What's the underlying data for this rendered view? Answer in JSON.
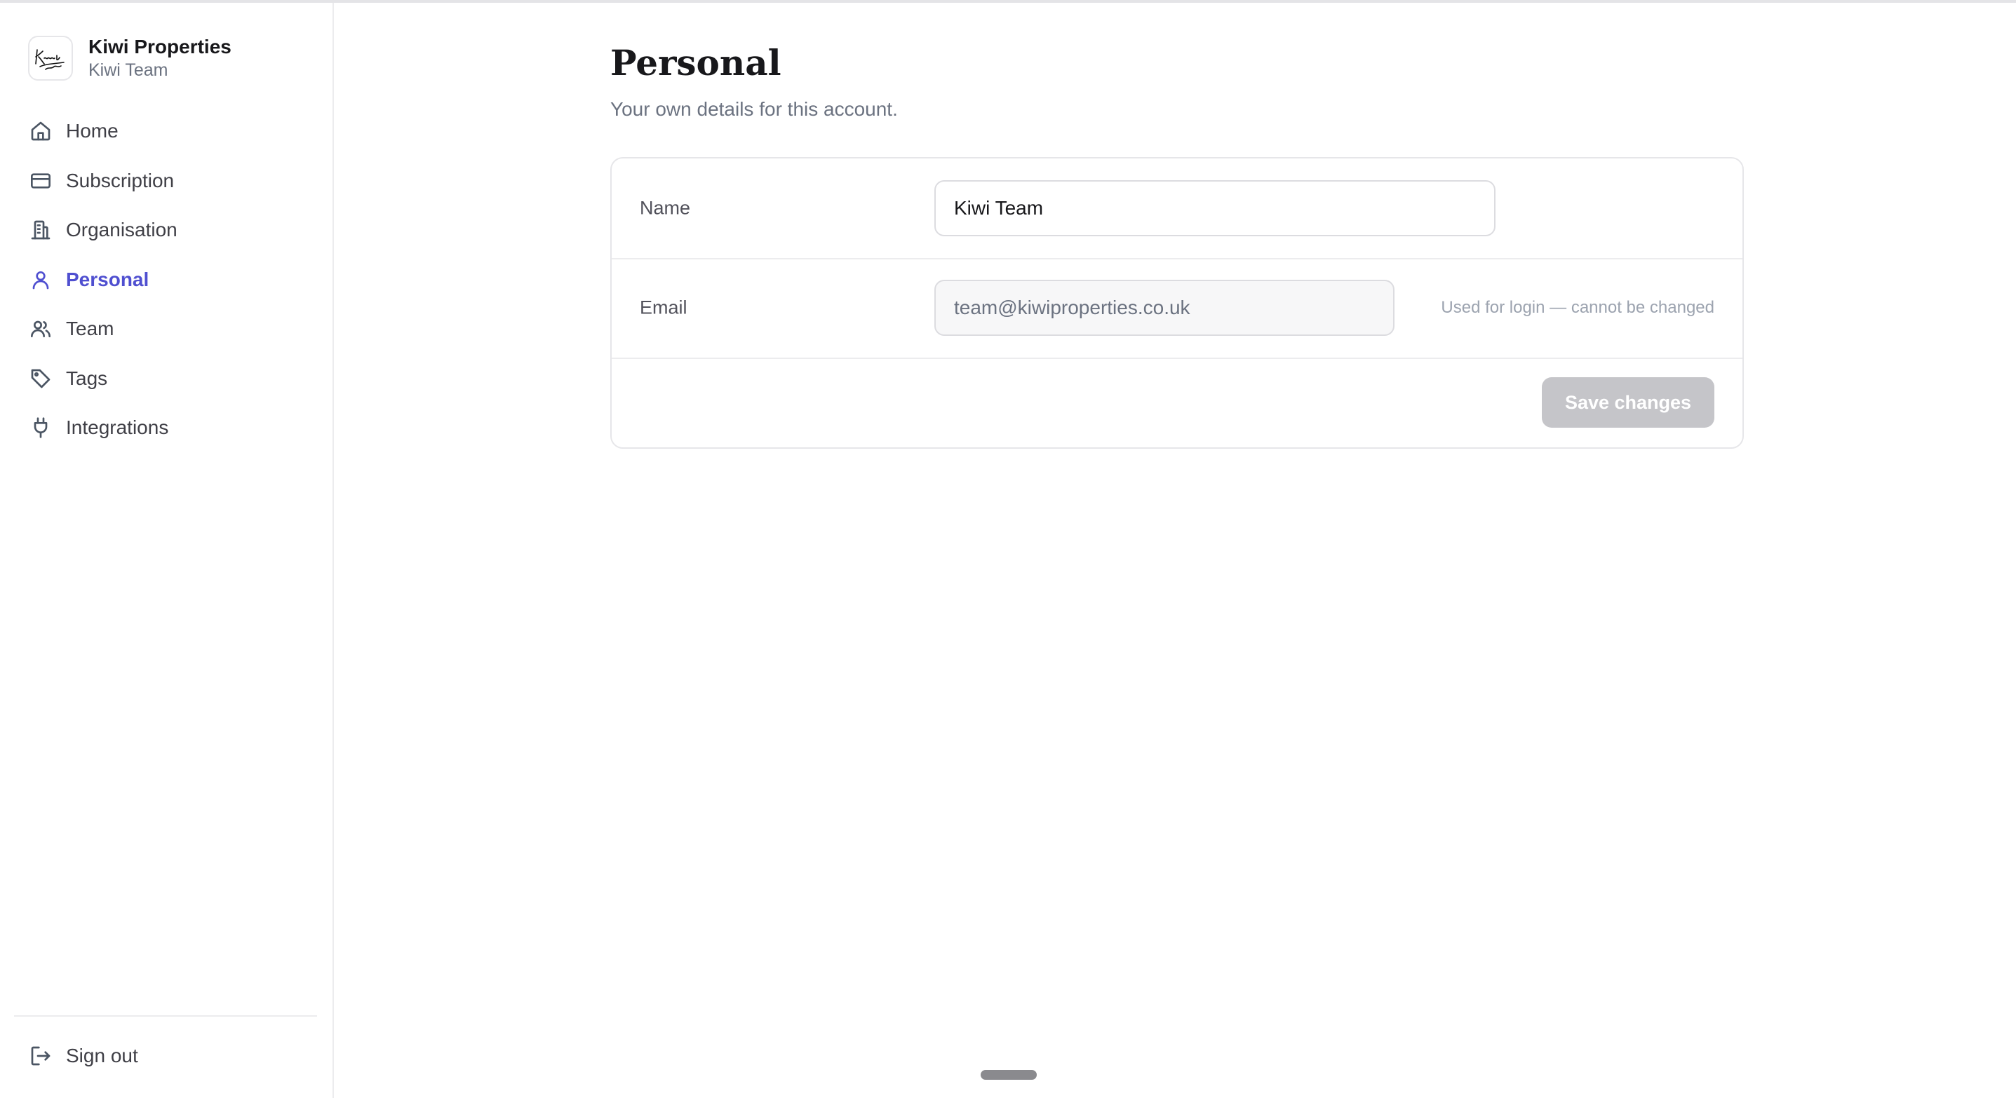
{
  "brand": {
    "name": "Kiwi Properties",
    "subtitle": "Kiwi Team",
    "logo_icon": "kiwi-signature-logo"
  },
  "sidebar": {
    "items": [
      {
        "label": "Home",
        "icon": "home-icon",
        "active": false
      },
      {
        "label": "Subscription",
        "icon": "credit-card-icon",
        "active": false
      },
      {
        "label": "Organisation",
        "icon": "building-icon",
        "active": false
      },
      {
        "label": "Personal",
        "icon": "user-icon",
        "active": true
      },
      {
        "label": "Team",
        "icon": "users-icon",
        "active": false
      },
      {
        "label": "Tags",
        "icon": "tag-icon",
        "active": false
      },
      {
        "label": "Integrations",
        "icon": "plug-icon",
        "active": false
      }
    ],
    "sign_out": {
      "label": "Sign out",
      "icon": "sign-out-icon"
    }
  },
  "main": {
    "title": "Personal",
    "subtitle": "Your own details for this account.",
    "form": {
      "name_label": "Name",
      "name_value": "Kiwi Team",
      "email_label": "Email",
      "email_value": "team@kiwiproperties.co.uk",
      "email_hint": "Used for login — cannot be changed",
      "save_label": "Save changes",
      "save_disabled": true
    }
  },
  "colors": {
    "accent": "#4f4fd0",
    "text": "#18181b",
    "muted": "#6b7280",
    "border": "#e6e6e9",
    "button_disabled": "#c5c5c9"
  }
}
